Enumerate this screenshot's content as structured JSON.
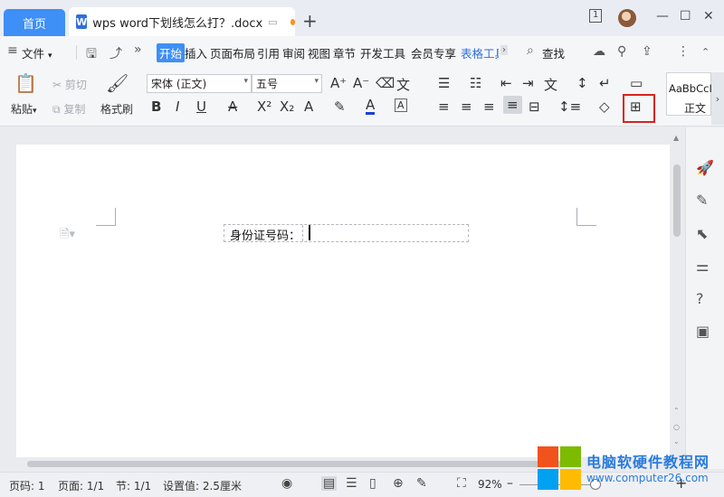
{
  "titlebar": {
    "home_tab": "首页",
    "doc_tab_icon": "W",
    "doc_tab_title": "wps word下划线怎么打？.docx",
    "new_tab": "+",
    "page_indicator": "1",
    "minimize": "—",
    "maximize": "☐",
    "close": "✕",
    "unsaved_dot_color": "#f7931e"
  },
  "menubar": {
    "file": "文件",
    "tabs": [
      "开始",
      "插入",
      "页面布局",
      "引用",
      "审阅",
      "视图",
      "章节",
      "开发工具",
      "会员专享",
      "表格工具"
    ],
    "search": "查找"
  },
  "ribbon": {
    "paste": "粘贴",
    "cut": "剪切",
    "copy": "复制",
    "format_painter": "格式刷",
    "font_name": "宋体 (正文)",
    "font_size": "五号",
    "style_sample": "AaBbCcI",
    "style_name": "正文"
  },
  "document": {
    "field_label": "身份证号码："
  },
  "statusbar": {
    "page_num": "页码: 1",
    "pages": "页面: 1/1",
    "section": "节: 1/1",
    "setting": "设置值: 2.5厘米",
    "zoom": "92%"
  },
  "watermark": {
    "title": "电脑软硬件教程网",
    "url": "www.computer26.com"
  },
  "colors": {
    "accent": "#3e8ff6",
    "highlight_box": "#d9221c",
    "watermark": "#2a7bde"
  }
}
